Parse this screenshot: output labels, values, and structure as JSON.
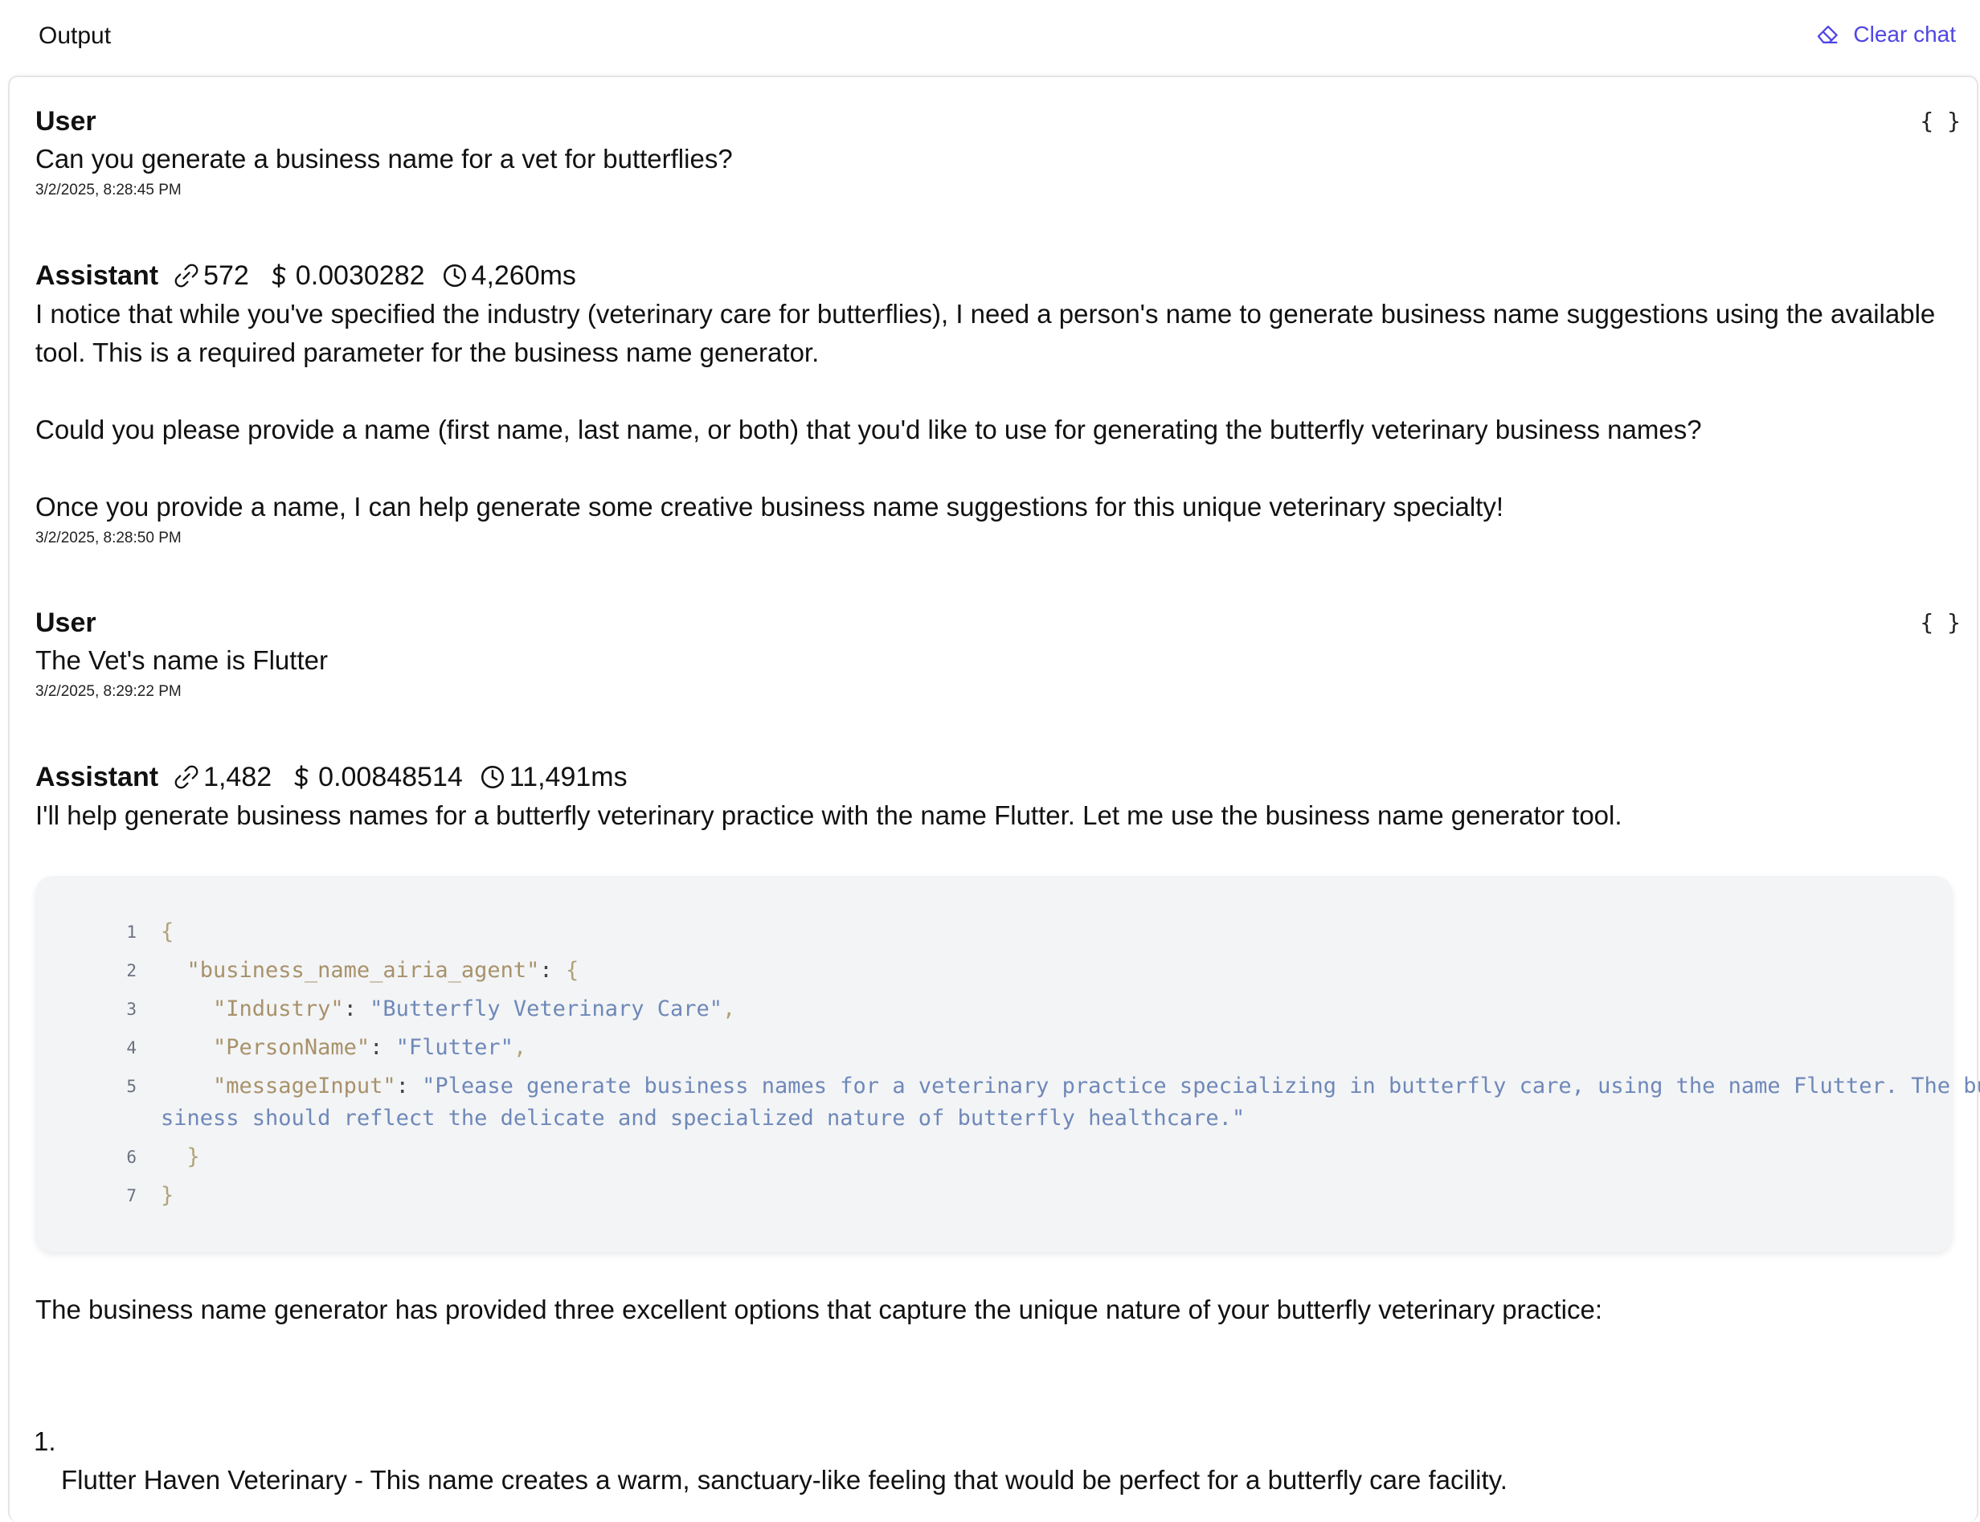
{
  "header": {
    "title": "Output",
    "clear_chat_label": "Clear chat"
  },
  "messages": [
    {
      "role": "User",
      "text": "Can you generate a business name for a vet for butterflies?",
      "timestamp": "3/2/2025, 8:28:45 PM",
      "braces": "{ }"
    },
    {
      "role": "Assistant",
      "tokens": "572",
      "cost": "0.0030282",
      "duration": "4,260ms",
      "paragraphs": [
        "I notice that while you've specified the industry (veterinary care for butterflies), I need a person's name to generate business name suggestions using the available tool. This is a required parameter for the business name generator.",
        "Could you please provide a name (first name, last name, or both) that you'd like to use for generating the butterfly veterinary business names?",
        "Once you provide a name, I can help generate some creative business name suggestions for this unique veterinary specialty!"
      ],
      "timestamp": "3/2/2025, 8:28:50 PM"
    },
    {
      "role": "User",
      "text": "The Vet's name is Flutter",
      "timestamp": "3/2/2025, 8:29:22 PM",
      "braces": "{ }"
    },
    {
      "role": "Assistant",
      "tokens": "1,482",
      "cost": "0.00848514",
      "duration": "11,491ms",
      "intro": "I'll help generate business names for a butterfly veterinary practice with the name Flutter. Let me use the business name generator tool.",
      "code": {
        "line_numbers": [
          "1",
          "2",
          "3",
          "4",
          "5",
          "6",
          "7"
        ],
        "open_brace": "{",
        "agent_key": "\"business_name_airia_agent\"",
        "industry_key": "\"Industry\"",
        "industry_value": "\"Butterfly Veterinary Care\"",
        "person_key": "\"PersonName\"",
        "person_value": "\"Flutter\"",
        "message_key": "\"messageInput\"",
        "message_value_line1": "\"Please generate business names for a veterinary practice specializing in butterfly care, using the name Flutter. The bu",
        "message_value_line2": "siness should reflect the delicate and specialized nature of butterfly healthcare.\"",
        "close_inner": "}",
        "close_outer": "}"
      },
      "outro": "The business name generator has provided three excellent options that capture the unique nature of your butterfly veterinary practice:",
      "list": [
        {
          "number": "1.",
          "text": "Flutter Haven Veterinary - This name creates a warm, sanctuary-like feeling that would be perfect for a butterfly care facility."
        }
      ]
    }
  ],
  "colors": {
    "accent": "#4f46e5",
    "code_bg": "#f3f4f6",
    "code_key": "#a8926a",
    "code_string": "#6e88b8"
  },
  "icons": [
    "eraser-icon",
    "tokens-icon",
    "dollar-icon",
    "clock-icon"
  ]
}
